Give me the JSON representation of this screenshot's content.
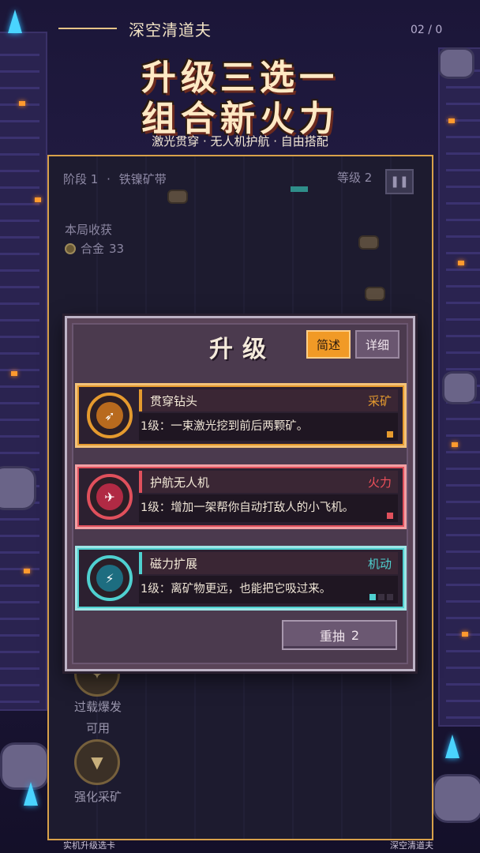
{
  "header": {
    "game_name": "深空清道夫",
    "page_counter": "02 / 0",
    "headline_1": "升级三选一",
    "headline_2": "组合新火力",
    "subhead": "激光贯穿 · 无人机护航 · 自由搭配"
  },
  "hud": {
    "stage_label": "阶段",
    "stage_num": "1",
    "stage_name": "铁镍矿带",
    "level_label": "等级",
    "level_num": "2",
    "pause_icon": "pause-icon",
    "xp_progress": 0.1,
    "haul_title": "本局收获",
    "currency_name": "合金",
    "currency_amount": "33"
  },
  "side_skills": [
    {
      "label": "过载爆发",
      "status": "可用",
      "icon": "burst-icon"
    },
    {
      "label": "强化采矿",
      "icon": "drill-icon"
    }
  ],
  "dialog": {
    "title": "升级",
    "tab_brief": "简述",
    "tab_detail": "详细",
    "selected_tab": "简述",
    "cards": [
      {
        "name": "贯穿钻头",
        "tag": "采矿",
        "desc": "1级：一束激光挖到前后两颗矿。",
        "icon": "drill-bit-icon",
        "color": "#e59a2e",
        "pips_filled": 1,
        "pips_total": 1
      },
      {
        "name": "护航无人机",
        "tag": "火力",
        "desc": "1级：增加一架帮你自动打敌人的小飞机。",
        "icon": "drone-icon",
        "color": "#e0505c",
        "pips_filled": 1,
        "pips_total": 1
      },
      {
        "name": "磁力扩展",
        "tag": "机动",
        "desc": "1级：离矿物更远，也能把它吸过来。",
        "icon": "magnet-bolt-icon",
        "color": "#4fd0d0",
        "pips_filled": 1,
        "pips_total": 3
      }
    ],
    "reroll_label": "重抽",
    "reroll_count": "2"
  },
  "footer": {
    "left": "实机升级选卡",
    "right": "深空清道夫"
  },
  "colors": {
    "accent_gold": "#e59a2e",
    "accent_red": "#e0505c",
    "accent_cyan": "#4fd0d0"
  }
}
